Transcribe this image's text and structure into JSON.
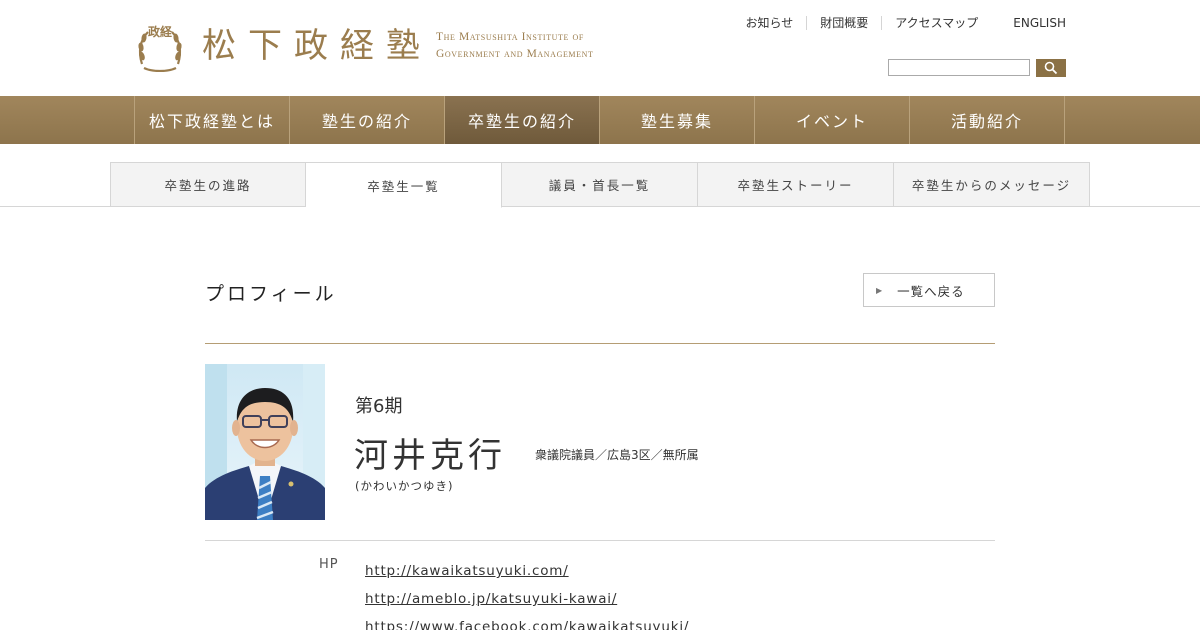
{
  "header": {
    "logo_seal_text": "政経",
    "logo_jp": "松下政経塾",
    "logo_en_line1": "The Matsushita Institute of",
    "logo_en_line2": "Government and Management",
    "util_links": [
      "お知らせ",
      "財団概要",
      "アクセスマップ"
    ],
    "english_label": "ENGLISH",
    "search_value": "",
    "search_icon": "search-icon"
  },
  "gnav": {
    "items": [
      "松下政経塾とは",
      "塾生の紹介",
      "卒塾生の紹介",
      "塾生募集",
      "イベント",
      "活動紹介"
    ],
    "active_index": 2
  },
  "subnav": {
    "items": [
      "卒塾生の進路",
      "卒塾生一覧",
      "議員・首長一覧",
      "卒塾生ストーリー",
      "卒塾生からのメッセージ"
    ],
    "active_index": 1
  },
  "profile": {
    "section_title": "プロフィール",
    "back_label": "一覧へ戻る",
    "period": "第6期",
    "name": "河井克行",
    "position": "衆議院議員／広島3区／無所属",
    "kana": "(かわいかつゆき)",
    "hp_label": "HP",
    "links": [
      "http://kawaikatsuyuki.com/",
      "http://ameblo.jp/katsuyuki-kawai/",
      "https://www.facebook.com/kawaikatsuyuki/"
    ]
  },
  "colors": {
    "brand_gold": "#9b7d4e",
    "nav_bg": "#96794f",
    "nav_active": "#7a6342",
    "search_btn": "#8b7145"
  }
}
